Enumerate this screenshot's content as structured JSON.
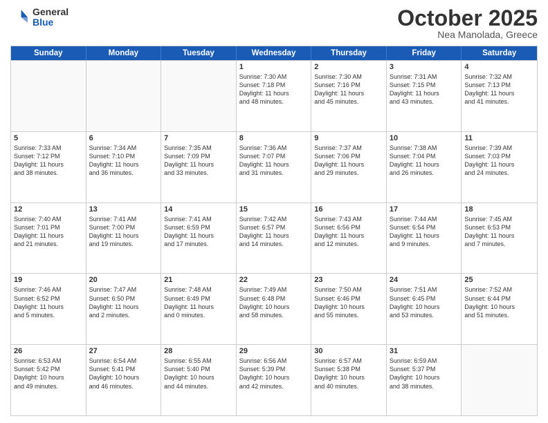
{
  "logo": {
    "general": "General",
    "blue": "Blue"
  },
  "title": "October 2025",
  "subtitle": "Nea Manolada, Greece",
  "header_days": [
    "Sunday",
    "Monday",
    "Tuesday",
    "Wednesday",
    "Thursday",
    "Friday",
    "Saturday"
  ],
  "weeks": [
    [
      {
        "day": "",
        "info": ""
      },
      {
        "day": "",
        "info": ""
      },
      {
        "day": "",
        "info": ""
      },
      {
        "day": "1",
        "info": "Sunrise: 7:30 AM\nSunset: 7:18 PM\nDaylight: 11 hours\nand 48 minutes."
      },
      {
        "day": "2",
        "info": "Sunrise: 7:30 AM\nSunset: 7:16 PM\nDaylight: 11 hours\nand 45 minutes."
      },
      {
        "day": "3",
        "info": "Sunrise: 7:31 AM\nSunset: 7:15 PM\nDaylight: 11 hours\nand 43 minutes."
      },
      {
        "day": "4",
        "info": "Sunrise: 7:32 AM\nSunset: 7:13 PM\nDaylight: 11 hours\nand 41 minutes."
      }
    ],
    [
      {
        "day": "5",
        "info": "Sunrise: 7:33 AM\nSunset: 7:12 PM\nDaylight: 11 hours\nand 38 minutes."
      },
      {
        "day": "6",
        "info": "Sunrise: 7:34 AM\nSunset: 7:10 PM\nDaylight: 11 hours\nand 36 minutes."
      },
      {
        "day": "7",
        "info": "Sunrise: 7:35 AM\nSunset: 7:09 PM\nDaylight: 11 hours\nand 33 minutes."
      },
      {
        "day": "8",
        "info": "Sunrise: 7:36 AM\nSunset: 7:07 PM\nDaylight: 11 hours\nand 31 minutes."
      },
      {
        "day": "9",
        "info": "Sunrise: 7:37 AM\nSunset: 7:06 PM\nDaylight: 11 hours\nand 29 minutes."
      },
      {
        "day": "10",
        "info": "Sunrise: 7:38 AM\nSunset: 7:04 PM\nDaylight: 11 hours\nand 26 minutes."
      },
      {
        "day": "11",
        "info": "Sunrise: 7:39 AM\nSunset: 7:03 PM\nDaylight: 11 hours\nand 24 minutes."
      }
    ],
    [
      {
        "day": "12",
        "info": "Sunrise: 7:40 AM\nSunset: 7:01 PM\nDaylight: 11 hours\nand 21 minutes."
      },
      {
        "day": "13",
        "info": "Sunrise: 7:41 AM\nSunset: 7:00 PM\nDaylight: 11 hours\nand 19 minutes."
      },
      {
        "day": "14",
        "info": "Sunrise: 7:41 AM\nSunset: 6:59 PM\nDaylight: 11 hours\nand 17 minutes."
      },
      {
        "day": "15",
        "info": "Sunrise: 7:42 AM\nSunset: 6:57 PM\nDaylight: 11 hours\nand 14 minutes."
      },
      {
        "day": "16",
        "info": "Sunrise: 7:43 AM\nSunset: 6:56 PM\nDaylight: 11 hours\nand 12 minutes."
      },
      {
        "day": "17",
        "info": "Sunrise: 7:44 AM\nSunset: 6:54 PM\nDaylight: 11 hours\nand 9 minutes."
      },
      {
        "day": "18",
        "info": "Sunrise: 7:45 AM\nSunset: 6:53 PM\nDaylight: 11 hours\nand 7 minutes."
      }
    ],
    [
      {
        "day": "19",
        "info": "Sunrise: 7:46 AM\nSunset: 6:52 PM\nDaylight: 11 hours\nand 5 minutes."
      },
      {
        "day": "20",
        "info": "Sunrise: 7:47 AM\nSunset: 6:50 PM\nDaylight: 11 hours\nand 2 minutes."
      },
      {
        "day": "21",
        "info": "Sunrise: 7:48 AM\nSunset: 6:49 PM\nDaylight: 11 hours\nand 0 minutes."
      },
      {
        "day": "22",
        "info": "Sunrise: 7:49 AM\nSunset: 6:48 PM\nDaylight: 10 hours\nand 58 minutes."
      },
      {
        "day": "23",
        "info": "Sunrise: 7:50 AM\nSunset: 6:46 PM\nDaylight: 10 hours\nand 55 minutes."
      },
      {
        "day": "24",
        "info": "Sunrise: 7:51 AM\nSunset: 6:45 PM\nDaylight: 10 hours\nand 53 minutes."
      },
      {
        "day": "25",
        "info": "Sunrise: 7:52 AM\nSunset: 6:44 PM\nDaylight: 10 hours\nand 51 minutes."
      }
    ],
    [
      {
        "day": "26",
        "info": "Sunrise: 6:53 AM\nSunset: 5:42 PM\nDaylight: 10 hours\nand 49 minutes."
      },
      {
        "day": "27",
        "info": "Sunrise: 6:54 AM\nSunset: 5:41 PM\nDaylight: 10 hours\nand 46 minutes."
      },
      {
        "day": "28",
        "info": "Sunrise: 6:55 AM\nSunset: 5:40 PM\nDaylight: 10 hours\nand 44 minutes."
      },
      {
        "day": "29",
        "info": "Sunrise: 6:56 AM\nSunset: 5:39 PM\nDaylight: 10 hours\nand 42 minutes."
      },
      {
        "day": "30",
        "info": "Sunrise: 6:57 AM\nSunset: 5:38 PM\nDaylight: 10 hours\nand 40 minutes."
      },
      {
        "day": "31",
        "info": "Sunrise: 6:59 AM\nSunset: 5:37 PM\nDaylight: 10 hours\nand 38 minutes."
      },
      {
        "day": "",
        "info": ""
      }
    ]
  ]
}
